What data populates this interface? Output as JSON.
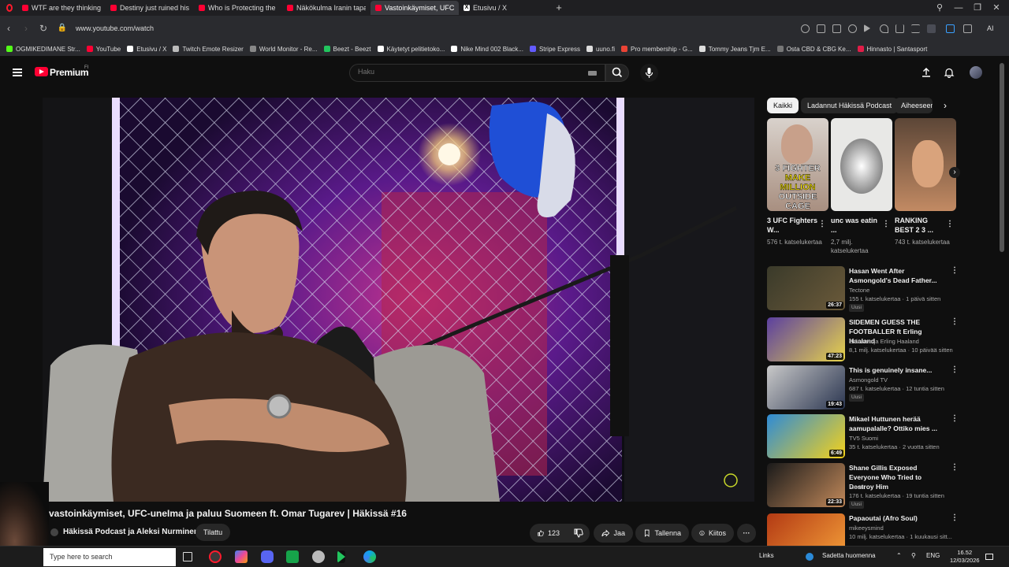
{
  "browser": {
    "tabs": [
      {
        "title": "WTF are they thinking? - Y",
        "favicon": "yt"
      },
      {
        "title": "Destiny just ruined his car",
        "favicon": "yt"
      },
      {
        "title": "Who is Protecting the Jeff",
        "favicon": "yt"
      },
      {
        "title": "Näkökulma Iranin tapaht",
        "favicon": "yt"
      },
      {
        "title": "Vastoinkäymiset, UFC",
        "favicon": "yt",
        "active": true
      },
      {
        "title": "Etusivu / X",
        "favicon": "x"
      }
    ],
    "url": "www.youtube.com/watch",
    "ai_label": "AI",
    "bookmarks": [
      {
        "label": "OGMIKEDIMANE Str...",
        "color": "#53fc18"
      },
      {
        "label": "YouTube",
        "color": "#ff0033"
      },
      {
        "label": "Etusivu / X",
        "color": "#ffffff"
      },
      {
        "label": "Twitch Emote Resizer",
        "color": "#bbbbbb"
      },
      {
        "label": "World Monitor - Re...",
        "color": "#888888"
      },
      {
        "label": "Beezt - Beezt",
        "color": "#22c55e"
      },
      {
        "label": "Käytetyt pelitietoko...",
        "color": "#ffffff"
      },
      {
        "label": "Nike Mind 002 Black...",
        "color": "#ffffff"
      },
      {
        "label": "Stripe Express",
        "color": "#635bff"
      },
      {
        "label": "uuno.fi",
        "color": "#dddddd"
      },
      {
        "label": "Pro membership - G...",
        "color": "#ea4335"
      },
      {
        "label": "Tommy Jeans Tjm E...",
        "color": "#dddddd"
      },
      {
        "label": "Osta CBD & CBG Ke...",
        "color": "#777777"
      },
      {
        "label": "Hinnasto | Santasport",
        "color": "#e11d48"
      }
    ]
  },
  "youtube": {
    "logo_text": "Premium",
    "region": "FI",
    "search_placeholder": "Haku",
    "video_title": "vastoinkäymiset, UFC-uneIma ja paluu Suomeen ft. Omar Tugarev | Häkissä #16",
    "channel": "Häkissä Podcast ja Aleksi Nurminen",
    "subscribe_label": "Tilattu",
    "actions": {
      "like_count": "123",
      "share": "Jaa",
      "save": "Tallenna",
      "thanks": "Kiitos"
    },
    "chips": [
      {
        "label": "Kaikki",
        "active": true
      },
      {
        "label": "Ladannut Häkissä Podcast"
      },
      {
        "label": "Aiheeseen"
      }
    ],
    "shorts": [
      {
        "title": "3 UFC Fighters W...",
        "views": "576 t. katselukertaa",
        "overlay": [
          "3 FIGHTER",
          "MAKE MILLION",
          "OUTSIDE CAGE"
        ]
      },
      {
        "title": "unc was eatin ...",
        "views": "2,7 milj. katselukertaa"
      },
      {
        "title": "RANKING BEST 2 3 ...",
        "views": "743 t. katselukertaa"
      }
    ],
    "recommendations": [
      {
        "title": "Hasan Went After Asmongold's Dead Father...",
        "channel": "Tectone",
        "meta": "155 t. katselukertaa · 1 päivä sitten",
        "duration": "26:37",
        "badge": "Uusi",
        "colors": [
          "#3a3a2a",
          "#6b5a3a"
        ]
      },
      {
        "title": "SIDEMEN GUESS THE FOOTBALLER ft Erling Haaland",
        "channel": "Sidemen ja Erling Haaland",
        "meta": "8,1 milj. katselukertaa · 10 päivää sitten",
        "duration": "47:23",
        "colors": [
          "#5b3fa0",
          "#e8d44a"
        ]
      },
      {
        "title": "This is genuinely insane...",
        "channel": "Asmongold TV",
        "meta": "687 t. katselukertaa · 12 tuntia sitten",
        "duration": "19:43",
        "badge": "Uusi",
        "colors": [
          "#c9c9c9",
          "#2a3550"
        ]
      },
      {
        "title": "Mikael Huttunen herää aamupalalle? Ottiko mies ...",
        "channel": "TV5 Suomi",
        "meta": "35 t. katselukertaa · 2 vuotta sitten",
        "duration": "6:49",
        "colors": [
          "#2e8bd6",
          "#f5d21a"
        ]
      },
      {
        "title": "Shane Gillis Exposed Everyone Who Tried to Destroy Him",
        "channel": "Moon",
        "meta": "176 t. katselukertaa · 19 tuntia sitten",
        "duration": "22:33",
        "badge": "Uusi",
        "colors": [
          "#1a1a1a",
          "#c2895a"
        ]
      },
      {
        "title": "Papaoutai (Afro Soul)",
        "channel": "mikeeysmind",
        "meta": "10 milj. katselukertaa · 1 kuukausi sitt...",
        "duration": "",
        "colors": [
          "#b33a14",
          "#f29c38"
        ]
      }
    ]
  },
  "taskbar": {
    "search_placeholder": "Type here to search",
    "links": "Links",
    "weather": "Sadetta huomenna",
    "language": "ENG",
    "time": "16.52",
    "date": "12/03/2026"
  },
  "colors": {
    "accent_red": "#ff0033",
    "bg": "#0f0f0f",
    "chip_bg": "#272727"
  }
}
